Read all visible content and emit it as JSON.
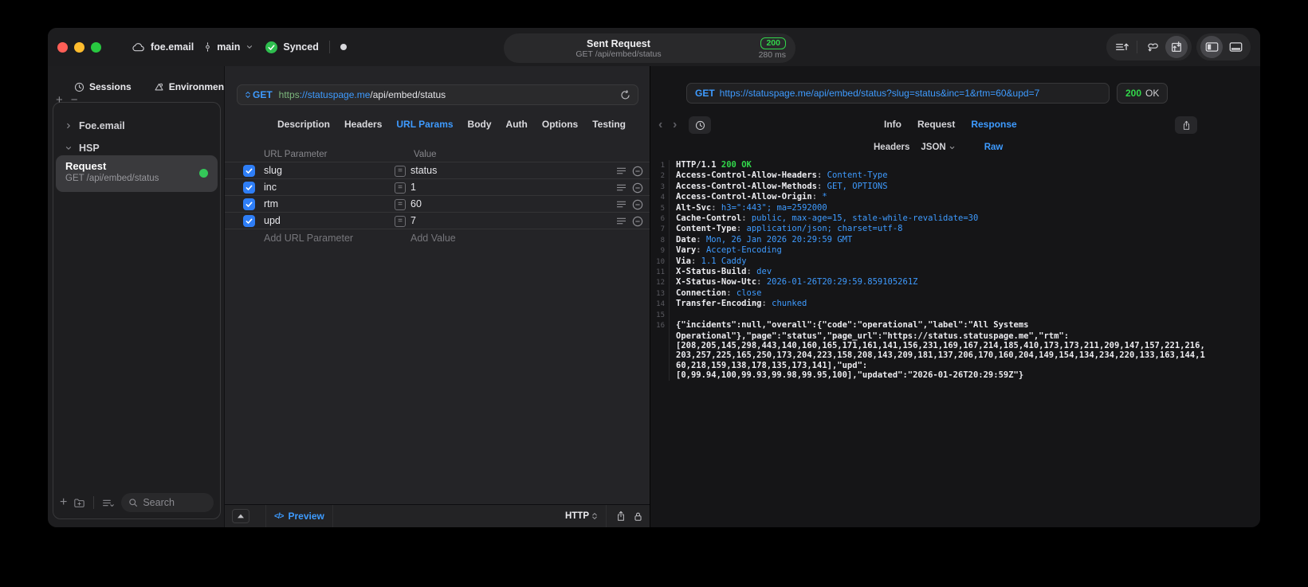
{
  "colors": {
    "accent": "#3e9bff",
    "green": "#32d74b",
    "checkbox": "#2e7ef7"
  },
  "icons": {
    "cloud-icon": "cloud outline",
    "commit-icon": "git commit",
    "chevron-down-icon": "v",
    "check-circle-icon": "green circle check",
    "status-dot": "white dot",
    "sort-lines-icon": "lines with up arrow",
    "cycle-icon": "looping arrows",
    "transfer-box-icon": "box with up/down arrows",
    "panel-left-icon": "sidebar layout",
    "panel-bottom-icon": "bottom bar layout",
    "clock-icon": "clock",
    "environments-icon": "triangle loop",
    "search-icon": "magnifier",
    "refresh-icon": "reload arrow",
    "hamburger-icon": "3 lines",
    "minus-circle-icon": "circled minus",
    "share-icon": "box with up arrow",
    "lock-icon": "padlock"
  },
  "titlebar": {
    "project": "foe.email",
    "branch": "main",
    "sync_status": "Synced",
    "request_pill": {
      "title": "Sent Request",
      "subtitle": "GET /api/embed/status",
      "status_code": "200",
      "duration": "280 ms"
    }
  },
  "sidebar": {
    "tabs": [
      {
        "label": "Sessions"
      },
      {
        "label": "Environments"
      }
    ],
    "tree": [
      {
        "label": "Foe.email",
        "expanded": false
      },
      {
        "label": "HSP",
        "expanded": true
      }
    ],
    "selected_request": {
      "name": "Request",
      "method_path": "GET /api/embed/status"
    },
    "search_placeholder": "Search"
  },
  "request_editor": {
    "method": "GET",
    "url": {
      "scheme": "https",
      "host": "://statuspage.me",
      "path": "/api/embed/status"
    },
    "tabs": [
      "Description",
      "Headers",
      "URL Params",
      "Body",
      "Auth",
      "Options",
      "Testing"
    ],
    "active_tab": "URL Params",
    "params": {
      "columns": [
        "URL Parameter",
        "Value"
      ],
      "rows": [
        {
          "name": "slug",
          "value": "status",
          "enabled": true
        },
        {
          "name": "inc",
          "value": "1",
          "enabled": true
        },
        {
          "name": "rtm",
          "value": "60",
          "enabled": true
        },
        {
          "name": "upd",
          "value": "7",
          "enabled": true
        }
      ],
      "add_name_placeholder": "Add URL Parameter",
      "add_value_placeholder": "Add Value"
    },
    "footer": {
      "preview_label": "Preview",
      "code_glyph": "</>",
      "protocol": "HTTP"
    }
  },
  "response_panel": {
    "request_line": {
      "method": "GET",
      "url": "https://statuspage.me/api/embed/status?slug=status&inc=1&rtm=60&upd=7"
    },
    "status": {
      "code": "200",
      "text": "OK"
    },
    "tabs": [
      "Info",
      "Request",
      "Response"
    ],
    "active_tab": "Response",
    "view_tabs": [
      "Headers",
      "JSON",
      "Raw"
    ],
    "active_view": "Raw",
    "headers": [
      {
        "n": "1",
        "k": "HTTP/1.1",
        "sep": " ",
        "v": "200 OK",
        "c": "green"
      },
      {
        "n": "2",
        "k": "Access-Control-Allow-Headers",
        "sep": ": ",
        "v": "Content-Type"
      },
      {
        "n": "3",
        "k": "Access-Control-Allow-Methods",
        "sep": ": ",
        "v": "GET, OPTIONS"
      },
      {
        "n": "4",
        "k": "Access-Control-Allow-Origin",
        "sep": ": ",
        "v": "*"
      },
      {
        "n": "5",
        "k": "Alt-Svc",
        "sep": ": ",
        "v": "h3=\":443\"; ma=2592000"
      },
      {
        "n": "6",
        "k": "Cache-Control",
        "sep": ": ",
        "v": "public, max-age=15, stale-while-revalidate=30"
      },
      {
        "n": "7",
        "k": "Content-Type",
        "sep": ": ",
        "v": "application/json; charset=utf-8"
      },
      {
        "n": "8",
        "k": "Date",
        "sep": ": ",
        "v": "Mon, 26 Jan 2026 20:29:59 GMT"
      },
      {
        "n": "9",
        "k": "Vary",
        "sep": ": ",
        "v": "Accept-Encoding"
      },
      {
        "n": "10",
        "k": "Via",
        "sep": ": ",
        "v": "1.1 Caddy"
      },
      {
        "n": "11",
        "k": "X-Status-Build",
        "sep": ": ",
        "v": "dev"
      },
      {
        "n": "12",
        "k": "X-Status-Now-Utc",
        "sep": ": ",
        "v": "2026-01-26T20:29:59.859105261Z"
      },
      {
        "n": "13",
        "k": "Connection",
        "sep": ": ",
        "v": "close"
      },
      {
        "n": "14",
        "k": "Transfer-Encoding",
        "sep": ": ",
        "v": "chunked"
      },
      {
        "n": "15",
        "k": "",
        "sep": "",
        "v": ""
      }
    ],
    "body_lines": [
      {
        "n": "16",
        "t": "{\"incidents\":null,\"overall\":{\"code\":\"operational\",\"label\":\"All Systems"
      },
      {
        "n": "",
        "t": "Operational\"},\"page\":\"status\",\"page_url\":\"https://status.statuspage.me\",\"rtm\":"
      },
      {
        "n": "",
        "t": "[208,205,145,298,443,140,160,165,171,161,141,156,231,169,167,214,185,410,173,173,211,209,147,157,221,216,"
      },
      {
        "n": "",
        "t": "203,257,225,165,250,173,204,223,158,208,143,209,181,137,206,170,160,204,149,154,134,234,220,133,163,144,1"
      },
      {
        "n": "",
        "t": "60,218,159,138,178,135,173,141],\"upd\":"
      },
      {
        "n": "",
        "t": "[0,99.94,100,99.93,99.98,99.95,100],\"updated\":\"2026-01-26T20:29:59Z\"}"
      }
    ]
  }
}
